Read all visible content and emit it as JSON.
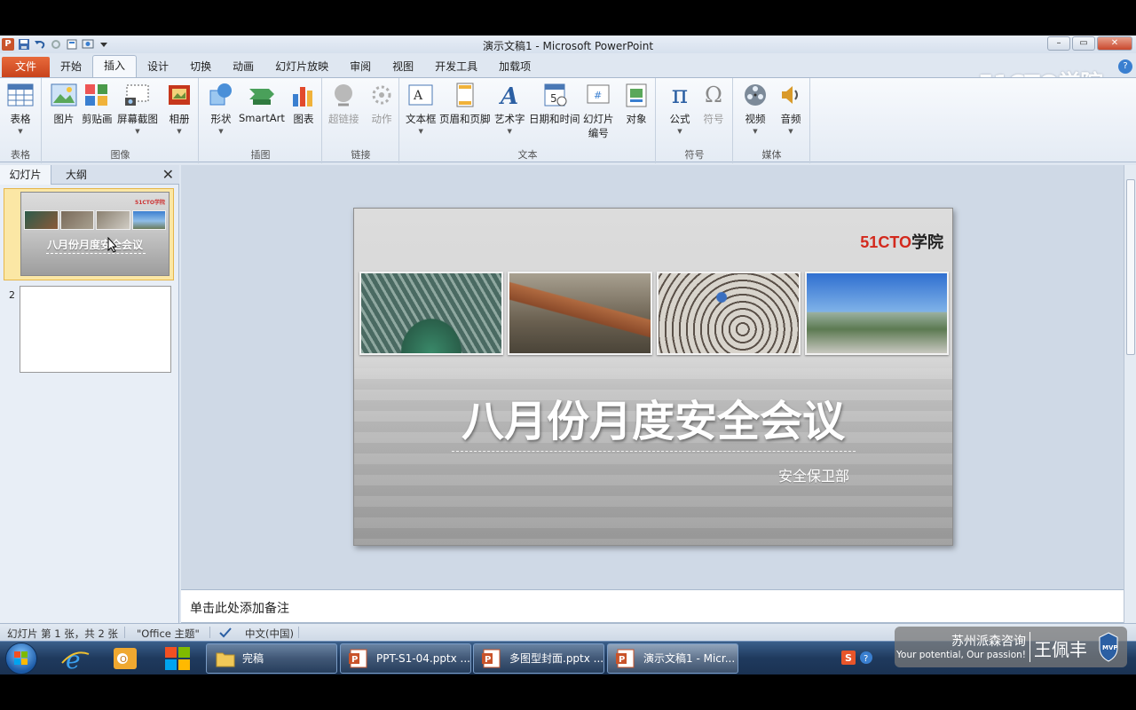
{
  "window": {
    "title": "演示文稿1 - Microsoft PowerPoint",
    "app_icon_label": "P",
    "buttons": {
      "minimize": "–",
      "maximize": "▭",
      "close": "✕"
    }
  },
  "tabs": [
    {
      "label": "文件"
    },
    {
      "label": "开始"
    },
    {
      "label": "插入"
    },
    {
      "label": "设计"
    },
    {
      "label": "切换"
    },
    {
      "label": "动画"
    },
    {
      "label": "幻灯片放映"
    },
    {
      "label": "审阅"
    },
    {
      "label": "视图"
    },
    {
      "label": "开发工具"
    },
    {
      "label": "加载项"
    }
  ],
  "watermark_top": "51CTO学院",
  "ribbon": {
    "groups": [
      {
        "label": "表格",
        "buttons": [
          "表格"
        ]
      },
      {
        "label": "图像",
        "buttons": [
          "图片",
          "剪贴画",
          "屏幕截图",
          "相册"
        ]
      },
      {
        "label": "插图",
        "buttons": [
          "形状",
          "SmartArt",
          "图表"
        ]
      },
      {
        "label": "链接",
        "buttons": [
          "超链接",
          "动作"
        ]
      },
      {
        "label": "文本",
        "buttons": [
          "文本框",
          "页眉和页脚",
          "艺术字",
          "日期和时间",
          "幻灯片",
          "对象"
        ],
        "extra": "编号"
      },
      {
        "label": "符号",
        "buttons": [
          "公式",
          "符号"
        ]
      },
      {
        "label": "媒体",
        "buttons": [
          "视频",
          "音频"
        ]
      }
    ],
    "formula_glyph": "π",
    "symbol_glyph": "Ω"
  },
  "left_pane": {
    "tabs": [
      "幻灯片",
      "大纲"
    ],
    "close": "✕",
    "slides": [
      {
        "num": "1",
        "title": "八月份月度安全会议",
        "logo": "51CTO学院"
      },
      {
        "num": "2"
      }
    ]
  },
  "slide": {
    "logo_red": "51CTO",
    "logo_black": "学院",
    "title": "八月份月度安全会议",
    "subtitle": "安全保卫部"
  },
  "notes_placeholder": "单击此处添加备注",
  "status": {
    "slide_info": "幻灯片 第 1 张，共 2 张",
    "theme": "\"Office 主题\"",
    "language": "中文(中国)"
  },
  "taskbar": {
    "buttons": [
      {
        "label": "完稿"
      },
      {
        "label": "PPT-S1-04.pptx ..."
      },
      {
        "label": "多图型封面.pptx ..."
      },
      {
        "label": "演示文稿1 - Micr..."
      }
    ]
  },
  "overlay": {
    "company": "苏州派森咨询",
    "slogan": "Your potential, Our passion!",
    "name": "王佩丰"
  }
}
